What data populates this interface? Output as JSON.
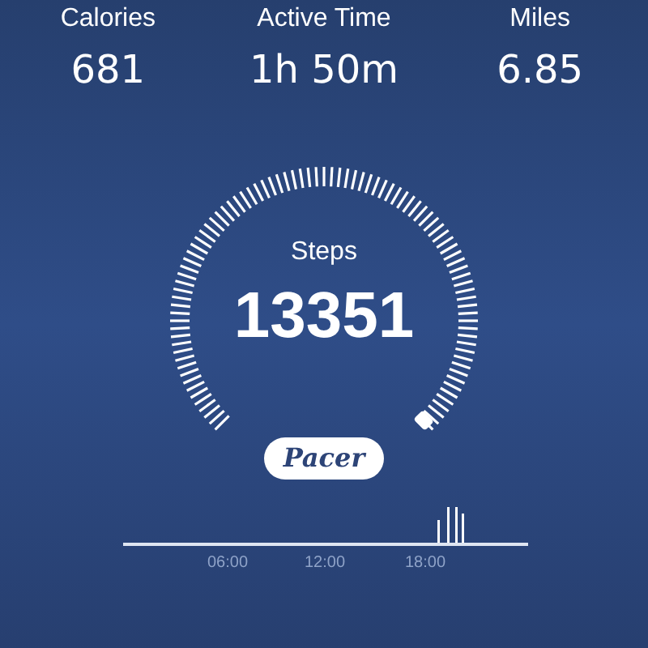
{
  "stats": [
    {
      "label": "Calories",
      "value": "681"
    },
    {
      "label": "Active Time",
      "value": "1h 50m"
    },
    {
      "label": "Miles",
      "value": "6.85"
    }
  ],
  "gauge": {
    "label": "Steps",
    "value": "13351"
  },
  "brand_button": {
    "label": "Pacer"
  },
  "activity_chart": {
    "axis_labels": [
      "06:00",
      "12:00",
      "18:00"
    ]
  }
}
